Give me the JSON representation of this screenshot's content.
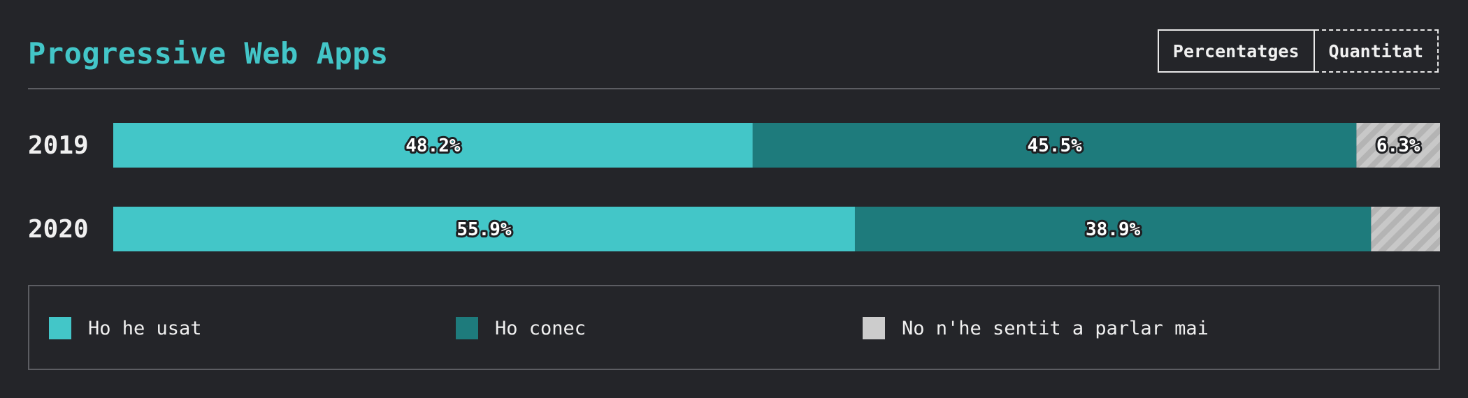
{
  "title": "Progressive Web Apps",
  "toggle": {
    "percent_label": "Percentatges",
    "count_label": "Quantitat"
  },
  "chart_data": {
    "type": "bar",
    "orientation": "horizontal",
    "stacked": true,
    "normalized": true,
    "categories": [
      "2019",
      "2020"
    ],
    "series": [
      {
        "name": "Ho he usat",
        "values": [
          48.2,
          55.9
        ],
        "color": "#43c6c8"
      },
      {
        "name": "Ho conec",
        "values": [
          45.5,
          38.9
        ],
        "color": "#1e7b7c"
      },
      {
        "name": "No n'he sentit a parlar mai",
        "values": [
          6.3,
          5.2
        ],
        "color": "#cccccc",
        "pattern": "diagonal-stripes",
        "labels_shown": [
          true,
          false
        ]
      }
    ],
    "value_format": "percent",
    "legend": "bottom"
  }
}
